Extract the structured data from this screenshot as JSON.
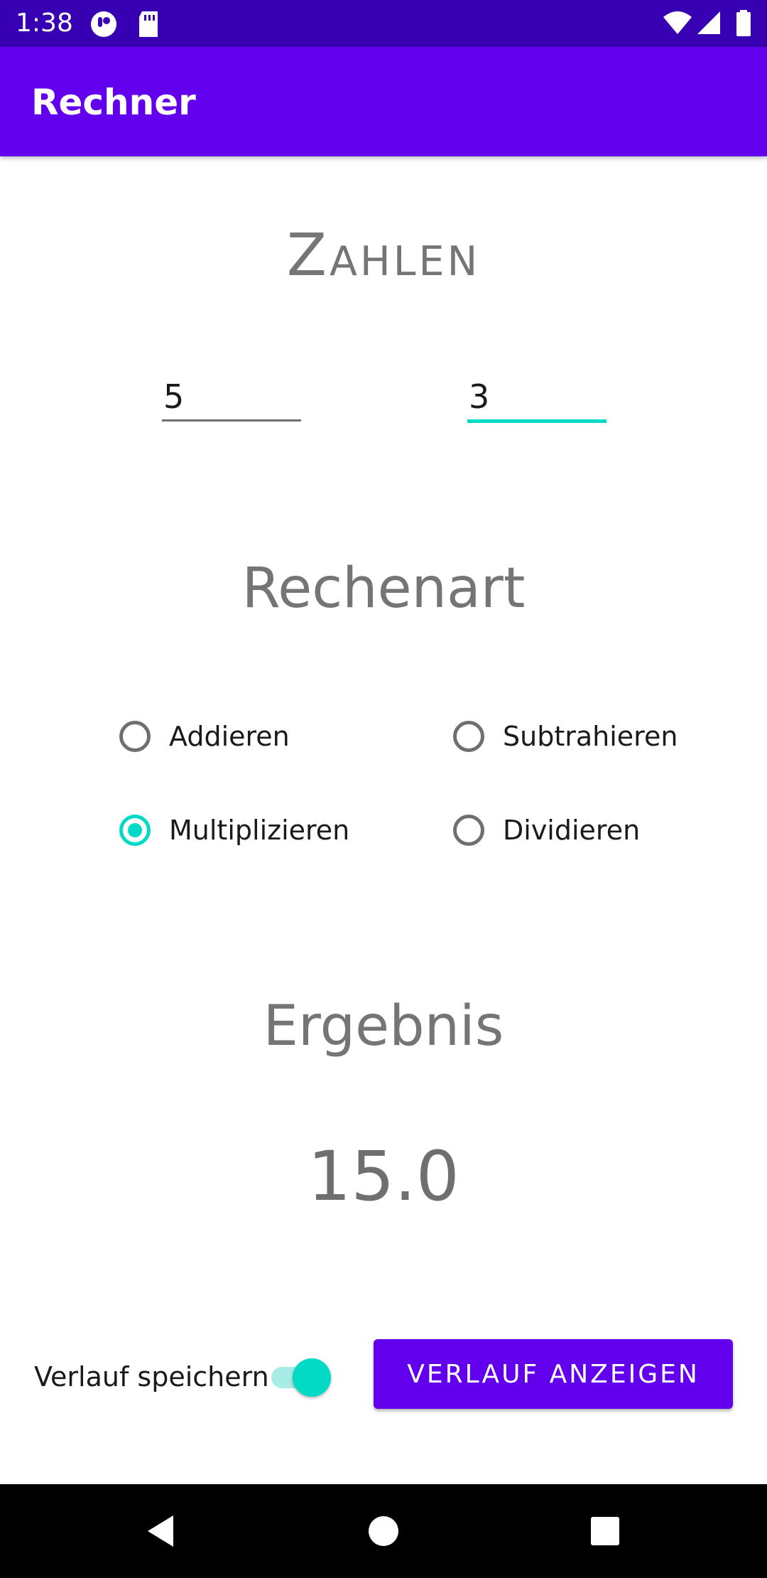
{
  "status_bar": {
    "time": "1:38",
    "icons": [
      "notification-app-icon",
      "sd-card-icon",
      "wifi-icon",
      "cell-signal-icon",
      "battery-icon"
    ]
  },
  "app_bar": {
    "title": "Rechner",
    "color": "#6200ee"
  },
  "numbers": {
    "heading": "Zahlen",
    "first_value": "5",
    "second_value": "3"
  },
  "operation": {
    "heading": "Rechenart",
    "options": [
      {
        "label": "Addieren",
        "checked": false
      },
      {
        "label": "Subtrahieren",
        "checked": false
      },
      {
        "label": "Multiplizieren",
        "checked": true
      },
      {
        "label": "Dividieren",
        "checked": false
      }
    ]
  },
  "result": {
    "heading": "Ergebnis",
    "value": "15.0"
  },
  "bottom": {
    "switch_label": "Verlauf speichern",
    "switch_on": true,
    "button_label": "VERLAUF ANZEIGEN"
  },
  "nav_bar": {
    "icons": [
      "back-icon",
      "home-icon",
      "recents-icon"
    ]
  },
  "colors": {
    "primary": "#6200ee",
    "primary_dark": "#3700b3",
    "accent": "#03dac5"
  }
}
